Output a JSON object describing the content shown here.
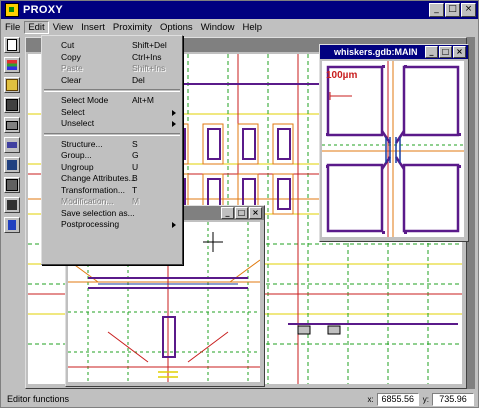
{
  "app": {
    "title": "PROXY"
  },
  "window_buttons": {
    "minimize": "_",
    "maximize": "□",
    "close": "×"
  },
  "menubar": [
    "File",
    "Edit",
    "View",
    "Insert",
    "Proximity",
    "Options",
    "Window",
    "Help"
  ],
  "edit_menu": [
    {
      "label": "Cut",
      "shortcut": "Shift+Del"
    },
    {
      "label": "Copy",
      "shortcut": "Ctrl+Ins"
    },
    {
      "label": "Paste",
      "shortcut": "Shift+Ins"
    },
    {
      "label": "Clear",
      "shortcut": "Del"
    },
    {
      "label": "Select Mode",
      "shortcut": "Alt+M"
    },
    {
      "label": "Select",
      "shortcut": ""
    },
    {
      "label": "Unselect",
      "shortcut": ""
    },
    {
      "label": "Structure...",
      "shortcut": "S"
    },
    {
      "label": "Group...",
      "shortcut": "G"
    },
    {
      "label": "Ungroup",
      "shortcut": "U"
    },
    {
      "label": "Change Attributes...",
      "shortcut": "B"
    },
    {
      "label": "Transformation...",
      "shortcut": "T"
    },
    {
      "label": "Modification...",
      "shortcut": "M"
    },
    {
      "label": "Save selection as...",
      "shortcut": ""
    },
    {
      "label": "Postprocessing",
      "shortcut": ""
    }
  ],
  "child_windows": {
    "whiskers": {
      "title": "whiskers.gdb:MAIN",
      "scale_label": "100µm"
    }
  },
  "status": {
    "message": "Editor functions",
    "x_label": "x:",
    "x_value": "6855.56",
    "y_label": "y:",
    "y_value": "735.96"
  },
  "toolbar_icons": [
    "new-icon",
    "layers-icon",
    "open-icon",
    "save-icon",
    "print-icon",
    "cut-icon",
    "copy-icon",
    "paste-icon",
    "zoom-icon",
    "help-icon",
    "cursor-icon",
    "circle-icon",
    "list-icon",
    "tree-icon"
  ],
  "colors": {
    "titlebar": "#000080",
    "face": "#c0c0c0",
    "layout_purple": "#5a1a8a",
    "layout_yellow": "#e0d000",
    "layout_green": "#20a020",
    "layout_red": "#c81e1e",
    "layout_orange": "#e07a10"
  }
}
